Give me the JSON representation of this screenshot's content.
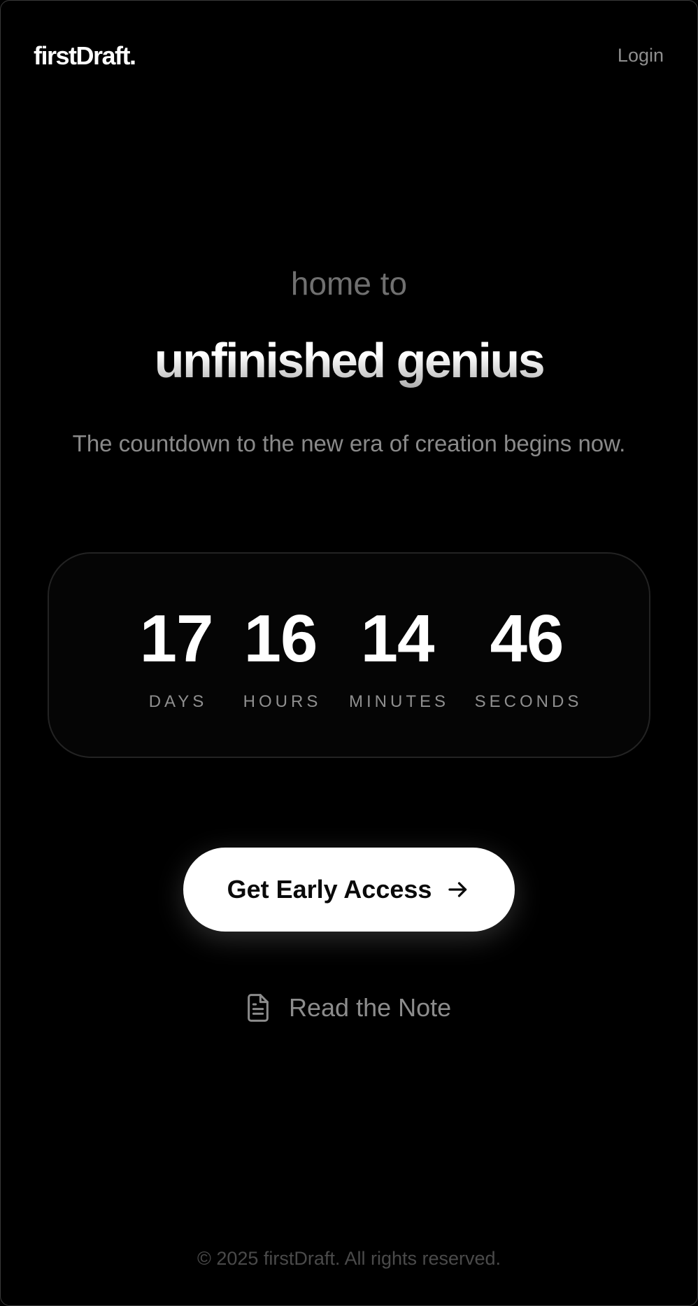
{
  "header": {
    "logo": "firstDraft.",
    "login_label": "Login"
  },
  "hero": {
    "kicker": "home to",
    "headline": "unfinished genius",
    "subhead": "The countdown to the new era of creation begins now."
  },
  "countdown": {
    "units": [
      {
        "value": "17",
        "label": "DAYS"
      },
      {
        "value": "16",
        "label": "HOURS"
      },
      {
        "value": "14",
        "label": "MINUTES"
      },
      {
        "value": "46",
        "label": "SECONDS"
      }
    ]
  },
  "actions": {
    "primary_label": "Get Early Access",
    "primary_icon": "arrow-right-icon",
    "secondary_label": "Read the Note",
    "secondary_icon": "document-icon"
  },
  "footer": {
    "copyright": "© 2025 firstDraft. All rights reserved."
  },
  "colors": {
    "background": "#000000",
    "text": "#ffffff",
    "muted": "#8a8a8a",
    "button_bg": "#ffffff"
  }
}
